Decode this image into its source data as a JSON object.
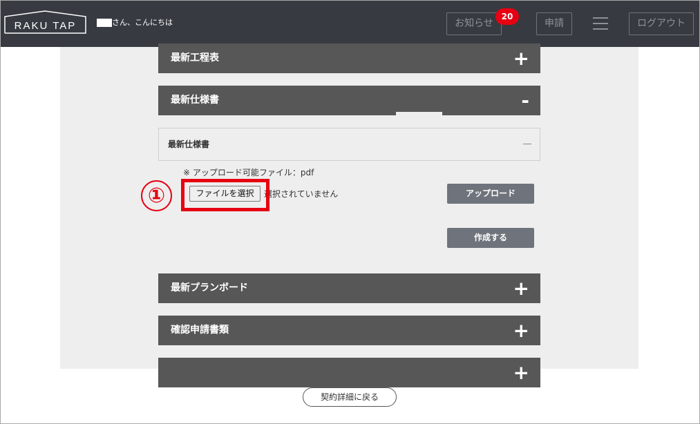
{
  "header": {
    "logo_text": "RAKU TAP",
    "greeting": "さん、こんにちは",
    "news_label": "お知らせ",
    "news_count": "20",
    "apply_label": "申請",
    "logout_label": "ログアウト"
  },
  "sections": {
    "schedule": {
      "title": "最新工程表",
      "sign": "+"
    },
    "spec": {
      "title": "最新仕様書",
      "sign": "-"
    },
    "planboard": {
      "title": "最新プランボード",
      "sign": "+"
    },
    "confirm": {
      "title": "確認申請書類",
      "sign": "+"
    },
    "hidden": {
      "title": "",
      "sign": "+"
    }
  },
  "spec_panel": {
    "title": "最新仕様書",
    "upload_note": "※ アップロード可能ファイル：pdf",
    "file_button_label": "ファイルを選択",
    "file_status": "選択されていません",
    "upload_button_label": "アップロード",
    "create_button_label": "作成する"
  },
  "annotation": {
    "step_number": "①"
  },
  "footer": {
    "back_label": "契約詳細に戻る"
  },
  "colors": {
    "header_bg": "#373b41",
    "section_bg": "#575757",
    "button_gray": "#6f737b",
    "highlight_red": "#e60012"
  }
}
